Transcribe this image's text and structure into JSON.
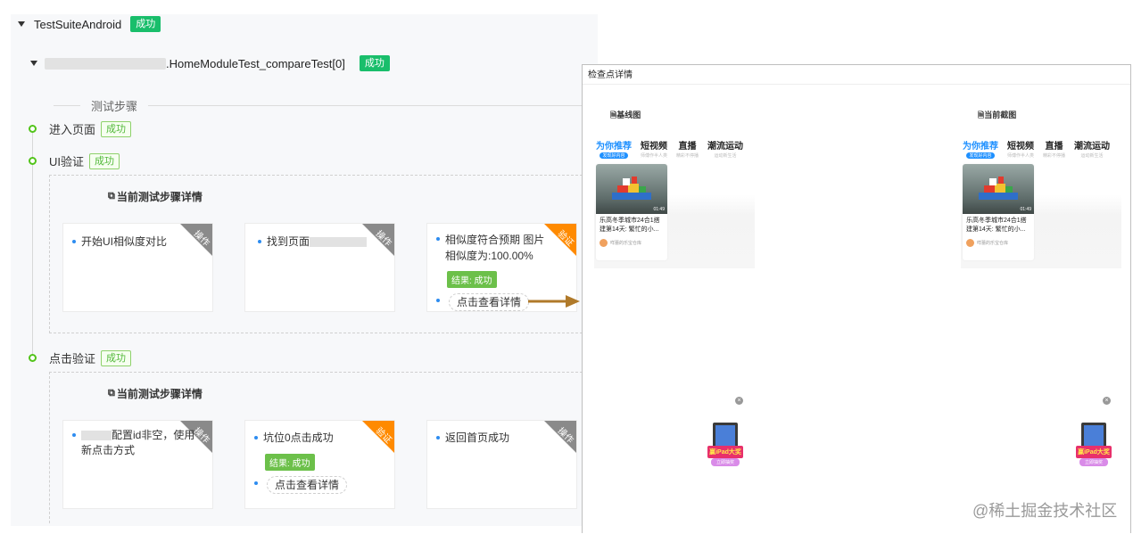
{
  "suite": {
    "name": "TestSuiteAndroid",
    "status": "成功"
  },
  "test": {
    "name_suffix": ".HomeModuleTest_compareTest[0]",
    "status": "成功"
  },
  "steps_label": "测试步骤",
  "steps": [
    {
      "label": "进入页面",
      "status": "成功"
    },
    {
      "label": "UI验证",
      "status": "成功"
    },
    {
      "label": "点击验证",
      "status": "成功"
    }
  ],
  "ui_detail": {
    "title": "当前测试步骤详情",
    "cards": [
      {
        "corner": "操作",
        "text": "开始UI相似度对比"
      },
      {
        "corner": "操作",
        "text": "找到页面"
      },
      {
        "corner": "验证",
        "text": "相似度符合预期 图片相似度为:100.00%",
        "result": "结果: 成功",
        "link": "点击查看详情"
      }
    ]
  },
  "click_detail": {
    "title": "当前测试步骤详情",
    "cards": [
      {
        "corner": "操作",
        "text": "配置id非空，使用新点击方式"
      },
      {
        "corner": "验证",
        "text": "坑位0点击成功",
        "result": "结果: 成功",
        "link": "点击查看详情"
      },
      {
        "corner": "操作",
        "text": "返回首页成功"
      }
    ]
  },
  "checkpoint": {
    "title": "检查点详情",
    "baseline_label": "基线图",
    "current_label": "当前截图",
    "tabs": [
      {
        "title": "为你推荐",
        "sub": "发现好内容"
      },
      {
        "title": "短视频",
        "sub": "师傅作半人类"
      },
      {
        "title": "直播",
        "sub": "精彩不停播"
      },
      {
        "title": "潮流运动",
        "sub": "运动新生活"
      }
    ],
    "feed_card": {
      "duration": "01:49",
      "title": "乐高冬季城市24合1搭建第14天: 繁忙的小...",
      "author": "咩蕾的乐宝仓库"
    },
    "promo_text": "赢iPad大奖",
    "promo_button": "立即抽奖"
  },
  "watermark": "@稀土掘金技术社区",
  "colors": {
    "success": "#19be6b",
    "operate_corner": "#8a8a8a",
    "verify_corner": "#ff8a00",
    "accent": "#1e90ff",
    "arrow": "#b07a2a"
  }
}
